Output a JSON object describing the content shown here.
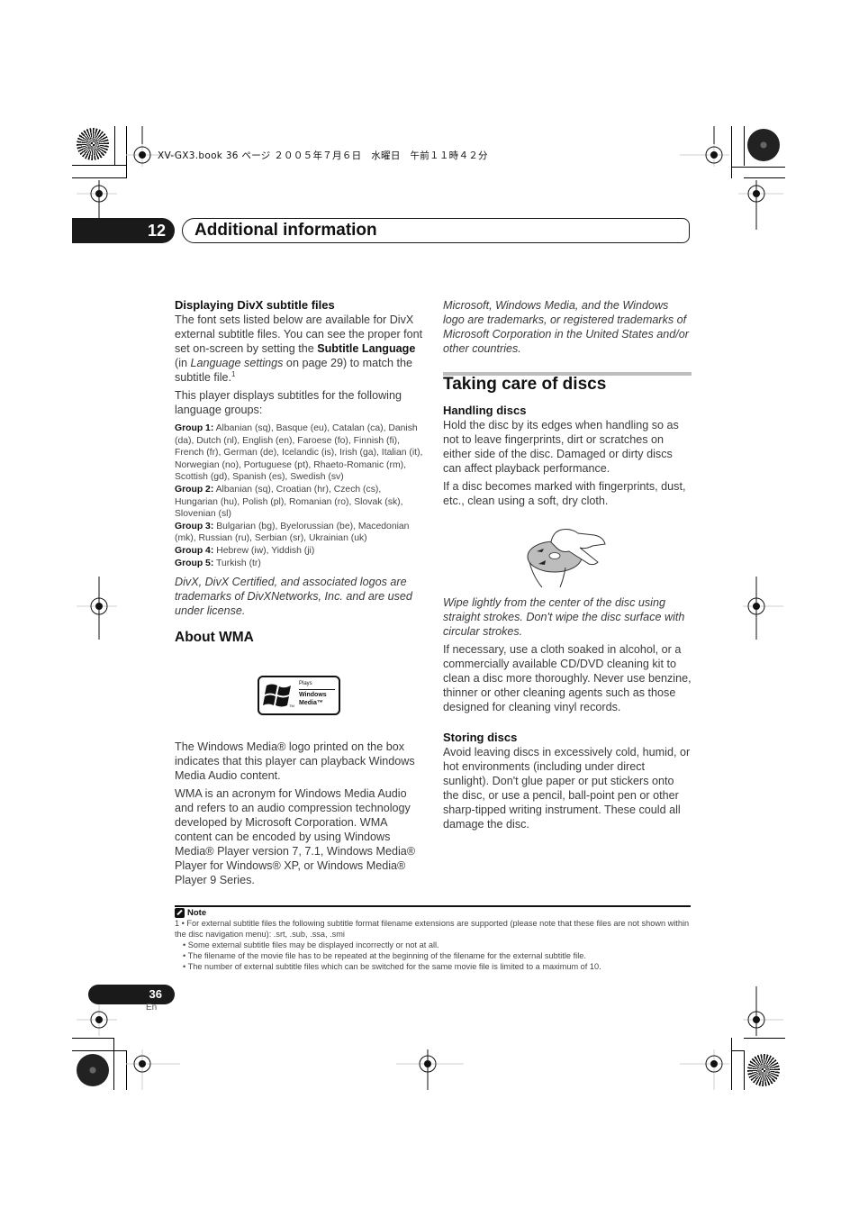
{
  "print_header": "XV-GX3.book  36 ページ  ２００５年７月６日　水曜日　午前１１時４２分",
  "chapter": {
    "number": "12",
    "title": "Additional information"
  },
  "left_column": {
    "divx_heading": "Displaying DivX subtitle files",
    "divx_para1_a": "The font sets listed below are available for DivX external subtitle files. You can see the proper font set on-screen by setting the ",
    "divx_para1_bold": "Subtitle Language",
    "divx_para1_b": " (in ",
    "divx_para1_italic": "Language settings",
    "divx_para1_c": " on page 29) to match the subtitle file.",
    "divx_para1_footnote": "1",
    "divx_para2": "This player displays subtitles for the following language groups:",
    "groups": [
      {
        "label": "Group 1:",
        "languages": "Albanian (sq), Basque (eu), Catalan (ca), Danish (da), Dutch (nl), English (en), Faroese (fo), Finnish (fi), French (fr), German (de), Icelandic (is), Irish (ga), Italian (it), Norwegian (no), Portuguese (pt), Rhaeto-Romanic (rm), Scottish (gd), Spanish (es), Swedish (sv)"
      },
      {
        "label": "Group 2:",
        "languages": "Albanian (sq), Croatian (hr), Czech (cs), Hungarian (hu), Polish (pl), Romanian (ro), Slovak (sk), Slovenian (sl)"
      },
      {
        "label": "Group 3:",
        "languages": "Bulgarian (bg), Byelorussian (be), Macedonian (mk), Russian (ru), Serbian (sr), Ukrainian (uk)"
      },
      {
        "label": "Group 4:",
        "languages": "Hebrew (iw), Yiddish (ji)"
      },
      {
        "label": "Group 5:",
        "languages": "Turkish (tr)"
      }
    ],
    "divx_trademark": "DivX, DivX Certified, and associated logos are trademarks of DivXNetworks, Inc. and are used under license.",
    "wma_heading": "About WMA",
    "wma_logo": {
      "line1": "Plays",
      "line2": "Windows",
      "line3": "Media™",
      "tm": "TM",
      "icon": "windows-flag-icon"
    },
    "wma_para1": "The Windows Media® logo printed on the box indicates that this player can playback Windows Media Audio content.",
    "wma_para2": "WMA is an acronym for Windows Media Audio and refers to an audio compression technology developed by Microsoft Corporation. WMA content can be encoded by using Windows Media® Player version 7, 7.1, Windows Media® Player for Windows® XP, or Windows Media® Player 9 Series."
  },
  "right_column": {
    "ms_trademark": "Microsoft, Windows Media, and the Windows logo are trademarks, or registered trademarks of Microsoft Corporation in the United States and/or other countries.",
    "section_heading": "Taking care of discs",
    "handling_heading": "Handling discs",
    "handling_para1": "Hold the disc by its edges when handling so as not to leave fingerprints, dirt or scratches on either side of the disc. Damaged or dirty discs can affect playback performance.",
    "handling_para2": "If a disc becomes marked with fingerprints, dust, etc., clean using a soft, dry cloth.",
    "illustration": "disc-wiping-illustration",
    "caption": "Wipe lightly from the center of the disc using straight strokes. Don't wipe the disc surface with circular strokes.",
    "handling_para3": "If necessary, use a cloth soaked in alcohol, or a commercially available CD/DVD cleaning kit to clean a disc more thoroughly. Never use benzine, thinner or other cleaning agents such as those designed for cleaning vinyl records.",
    "storing_heading": "Storing discs",
    "storing_para": "Avoid leaving discs in excessively cold, humid, or hot environments (including under direct sunlight). Don't glue paper or put stickers onto the disc, or use a pencil, ball-point pen or other sharp-tipped writing instrument. These could all damage the disc."
  },
  "note": {
    "label": "Note",
    "icon": "note-pencil-icon",
    "items": [
      "1  • For external subtitle files the following subtitle format filename extensions are supported (please note that these files are not shown within the disc navigation menu): .srt, .sub, .ssa, .smi",
      "• Some external subtitle files may be displayed incorrectly or not at all.",
      "• The filename of the movie file has to be repeated at the beginning of the filename for the external subtitle file.",
      "• The number of external subtitle files which can be switched for the same movie file is limited to a maximum of 10."
    ]
  },
  "footer": {
    "page_number": "36",
    "language": "En"
  }
}
